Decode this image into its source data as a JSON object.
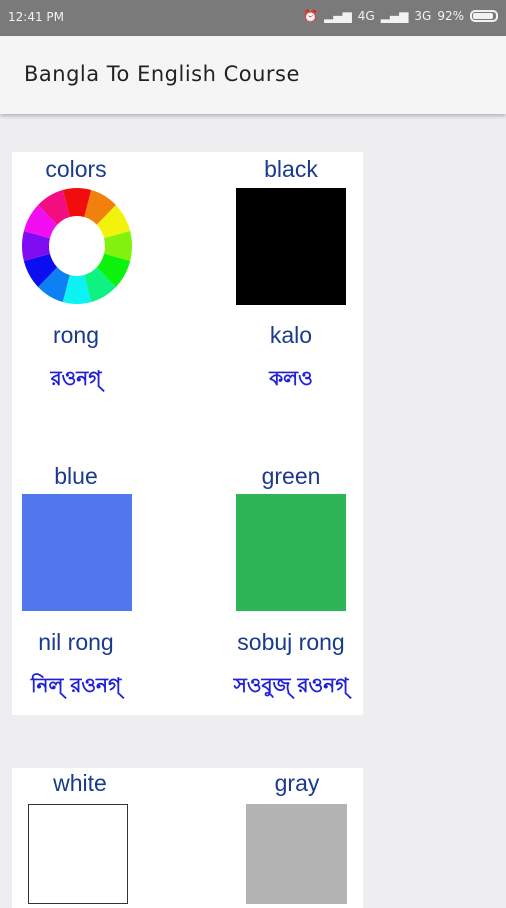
{
  "status_bar": {
    "time": "12:41 PM",
    "icons": [
      "alarm-icon",
      "signal-icon",
      "4g-icon",
      "volte-icon",
      "signal-icon-2",
      "3g-icon",
      "battery-icon"
    ],
    "network_labels": [
      "4G",
      "3G"
    ],
    "battery_text": "92%",
    "battery_level": 0.92
  },
  "app_bar": {
    "title": "Bangla To English Course"
  },
  "cards": [
    {
      "items": [
        {
          "english": "colors",
          "romanized": "rong",
          "bangla": "রওনগ্",
          "swatch": "color-wheel"
        },
        {
          "english": "black",
          "romanized": "kalo",
          "bangla": "কলও",
          "swatch": "#000000"
        },
        {
          "english": "blue",
          "romanized": "nil rong",
          "bangla": "নিল্ রওনগ্",
          "swatch": "#5177ee"
        },
        {
          "english": "green",
          "romanized": "sobuj rong",
          "bangla": "সওবুজ্ রওনগ্",
          "swatch": "#2db558"
        }
      ]
    },
    {
      "items": [
        {
          "english": "white",
          "swatch": "#ffffff"
        },
        {
          "english": "gray",
          "swatch": "#b3b3b3"
        }
      ]
    }
  ]
}
